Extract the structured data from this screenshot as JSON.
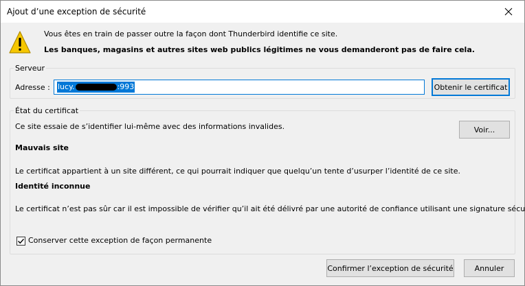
{
  "window": {
    "title": "Ajout d’une exception de sécurité"
  },
  "warning": {
    "line1": "Vous êtes en train de passer outre la façon dont Thunderbird identifie ce site.",
    "line2": "Les banques, magasins et autres sites web publics légitimes ne vous demanderont pas de faire cela."
  },
  "server": {
    "legend": "Serveur",
    "address_label": "Adresse :",
    "address_prefix": "lucy.",
    "address_suffix": ":993",
    "get_cert_label": "Obtenir le certificat"
  },
  "certificate": {
    "legend": "État du certificat",
    "status": "Ce site essaie de s’identifier lui-même avec des informations invalides.",
    "view_label": "Voir...",
    "bad_site_title": "Mauvais site",
    "bad_site_desc": "Le certificat appartient à un site différent, ce qui pourrait indiquer que quelqu’un tente d’usurper l’identité de ce site.",
    "unknown_identity_title": "Identité inconnue",
    "unknown_identity_desc": "Le certificat n’est pas sûr car il est impossible de vérifier qu’il ait été délivré par une autorité de confiance utilisant une signature sécurisée."
  },
  "permanent": {
    "checked": true,
    "label": "Conserver cette exception de façon permanente"
  },
  "buttons": {
    "confirm": "Confirmer l’exception de sécurité",
    "cancel": "Annuler"
  },
  "colors": {
    "accent": "#0078d7",
    "warning_yellow": "#f6c700"
  },
  "icons": {
    "warning": "warning-triangle-icon",
    "close": "close-icon",
    "checkmark": "checkmark-icon"
  }
}
